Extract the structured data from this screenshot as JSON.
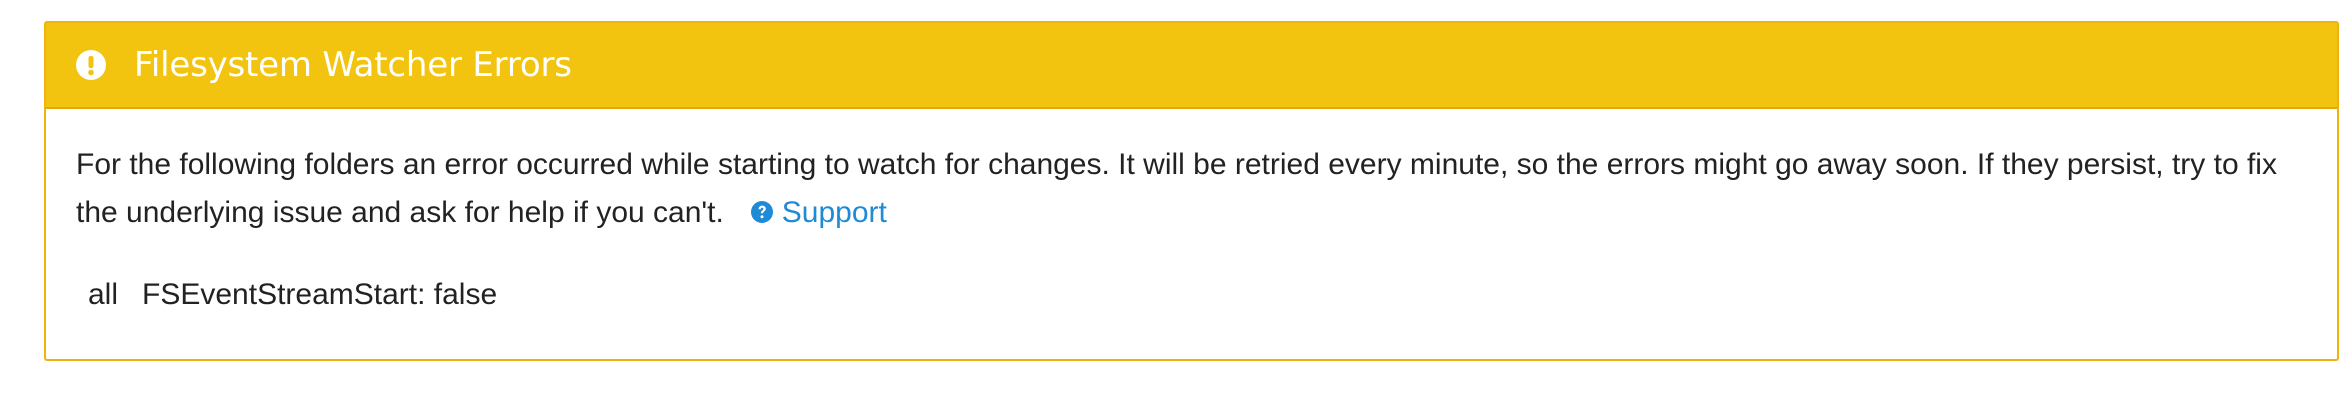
{
  "panel": {
    "title": "Filesystem Watcher Errors",
    "icon": "exclamation-circle-icon",
    "header_color": "#f2c40f",
    "border_color": "#f0b20e",
    "description": "For the following folders an error occurred while starting to watch for changes. It will be retried every minute, so the errors might go away soon. If they persist, try to fix the underlying issue and ask for help if you can't.",
    "support_link": {
      "label": "Support",
      "icon": "question-circle-icon",
      "color": "#1f8ad6"
    },
    "errors": [
      {
        "folder": "all",
        "message": "FSEventStreamStart: false"
      }
    ]
  }
}
